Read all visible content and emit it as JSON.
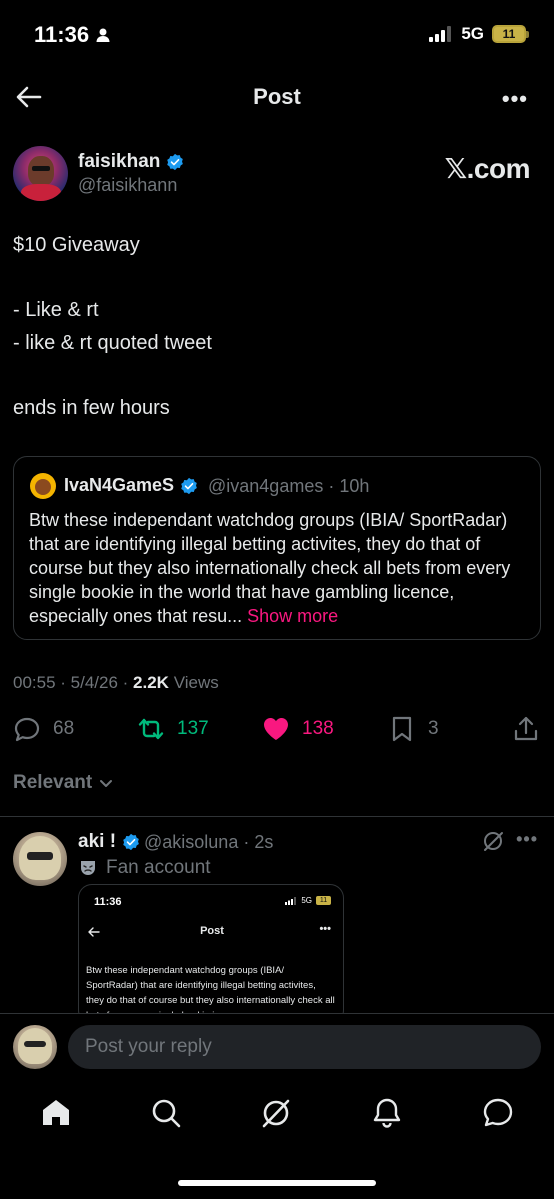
{
  "status_bar": {
    "time": "11:36",
    "network": "5G",
    "battery": "11"
  },
  "header": {
    "title": "Post"
  },
  "author": {
    "name": "faisikhan",
    "handle": "@faisikhann",
    "source": "𝕏.com"
  },
  "post": {
    "lines": [
      "$10 Giveaway",
      "- Like & rt",
      "- like & rt quoted tweet",
      "ends in few hours"
    ]
  },
  "quote": {
    "name": "IvaN4GameS",
    "meta": "@ivan4games · 10h",
    "text": "Btw these independant watchdog groups (IBIA/ SportRadar) that are identifying illegal betting activites, they do that of course but they also internationally check all bets from every single bookie in the world that have gambling licence, especially ones that resu...",
    "show_more": "Show more"
  },
  "meta": {
    "time": "00:55",
    "date": "5/4/26",
    "views_count": "2.2K",
    "views_label": "Views"
  },
  "actions": {
    "replies": "68",
    "reposts": "137",
    "likes": "138",
    "bookmarks": "3"
  },
  "colors": {
    "repost": "#00ba7c",
    "like": "#f91880",
    "verified": "#1d9bf0",
    "muted": "#71767b"
  },
  "sort": {
    "label": "Relevant"
  },
  "reply": {
    "name": "aki !",
    "meta": "@akisoluna · 2s",
    "fan_label": "Fan account",
    "embed": {
      "time": "11:36",
      "network": "5G",
      "battery": "11",
      "title": "Post",
      "text": "Btw these independant watchdog groups (IBIA/ SportRadar) that are identifying illegal betting activites, they do that of course but they also internationally check all bets from every single bookie in"
    }
  },
  "reply_bar": {
    "placeholder": "Post your reply"
  },
  "nav": [
    "home-icon",
    "search-icon",
    "grok-icon",
    "notifications-icon",
    "messages-icon"
  ]
}
